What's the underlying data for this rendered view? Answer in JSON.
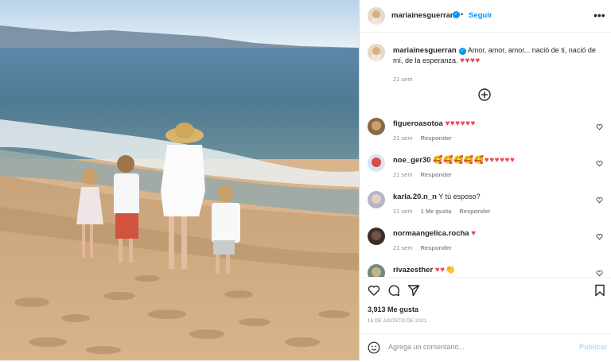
{
  "post": {
    "author": "mariainesguerran",
    "follow_label": "Seguir",
    "separator": "•",
    "more_label": "•••",
    "verified_mark": "✓",
    "caption_text": "Amor, amor, amor... nació de ti, nació de mí, de la esperanza.",
    "caption_hearts": "♥♥♥♥",
    "caption_time": "21 sem"
  },
  "comments": [
    {
      "user": "figueroasotoa",
      "text": "",
      "emojis": "♥♥♥♥♥♥",
      "time": "21 sem",
      "likes": "",
      "reply": "Responder"
    },
    {
      "user": "noe_ger30",
      "text": "",
      "emojis": "🥰🥰🥰🥰🥰♥♥♥♥♥♥",
      "time": "21 sem",
      "likes": "",
      "reply": "Responder"
    },
    {
      "user": "karla.20.n_n",
      "text": "Y tú esposo?",
      "emojis": "",
      "time": "21 sem",
      "likes": "1 Me gusta",
      "reply": "Responder"
    },
    {
      "user": "normaangelica.rocha",
      "text": "",
      "emojis": "♥",
      "time": "21 sem",
      "likes": "",
      "reply": "Responder"
    },
    {
      "user": "rivazesther",
      "text": "",
      "emojis": "♥♥👏",
      "time": "",
      "likes": "",
      "reply": ""
    }
  ],
  "footer": {
    "likes_count": "3,913 Me gusta",
    "date": "16 DE AGOSTO DE 2021",
    "comment_placeholder": "Agrega un comentario...",
    "publish_label": "Publicar"
  },
  "icons": {
    "like": "heart-icon",
    "comment": "comment-icon",
    "share": "share-icon",
    "save": "bookmark-icon",
    "emoji": "emoji-icon",
    "load_more": "plus-circle-icon"
  },
  "colors": {
    "accent": "#0095f6",
    "heart": "#ed4956",
    "muted": "#8e8e8e",
    "publish_disabled": "#b2dffc"
  }
}
